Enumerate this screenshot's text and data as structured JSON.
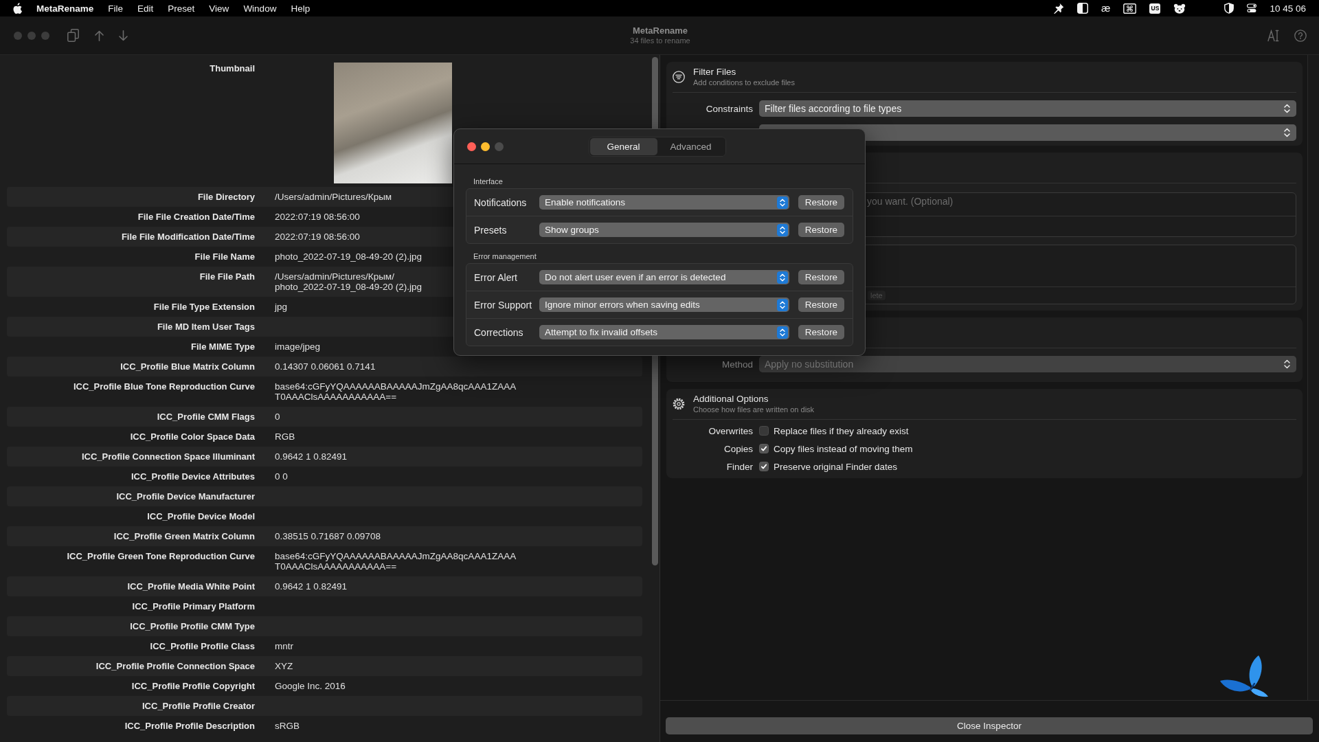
{
  "menu_bar": {
    "app_name": "MetaRename",
    "menus": [
      "File",
      "Edit",
      "Preset",
      "View",
      "Window",
      "Help"
    ],
    "input_glyph": "æ",
    "keyboard_layout": "US",
    "clock": "10 45 06"
  },
  "toolbar": {
    "title": "MetaRename",
    "subtitle": "34 files to rename"
  },
  "metadata": {
    "thumbnail_label": "Thumbnail",
    "rows": [
      {
        "label": "File Directory",
        "value": "/Users/admin/Pictures/Крым"
      },
      {
        "label": "File File Creation Date/Time",
        "value": "2022:07:19 08:56:00"
      },
      {
        "label": "File File Modification Date/Time",
        "value": "2022:07:19 08:56:00"
      },
      {
        "label": "File File Name",
        "value": "photo_2022-07-19_08-49-20 (2).jpg"
      },
      {
        "label": "File File Path",
        "value": "/Users/admin/Pictures/Крым/\nphoto_2022-07-19_08-49-20 (2).jpg"
      },
      {
        "label": "File File Type Extension",
        "value": "jpg"
      },
      {
        "label": "File MD Item User Tags"
      },
      {
        "label": "File MIME Type",
        "value": "image/jpeg"
      },
      {
        "label": "ICC_Profile Blue Matrix Column",
        "value": "0.14307 0.06061 0.7141"
      },
      {
        "label": "ICC_Profile Blue Tone Reproduction Curve",
        "value": "base64:cGFyYQAAAAAABAAAAAJmZgAA8qcAAA1ZAAA\nT0AAAClsAAAAAAAAAAA=="
      },
      {
        "label": "ICC_Profile CMM Flags",
        "value": "0"
      },
      {
        "label": "ICC_Profile Color Space Data",
        "value": "RGB"
      },
      {
        "label": "ICC_Profile Connection Space Illuminant",
        "value": "0.9642 1 0.82491"
      },
      {
        "label": "ICC_Profile Device Attributes",
        "value": "0 0"
      },
      {
        "label": "ICC_Profile Device Manufacturer"
      },
      {
        "label": "ICC_Profile Device Model"
      },
      {
        "label": "ICC_Profile Green Matrix Column",
        "value": "0.38515 0.71687 0.09708"
      },
      {
        "label": "ICC_Profile Green Tone Reproduction Curve",
        "value": "base64:cGFyYQAAAAAABAAAAAJmZgAA8qcAAA1ZAAA\nT0AAAClsAAAAAAAAAAA=="
      },
      {
        "label": "ICC_Profile Media White Point",
        "value": "0.9642 1 0.82491"
      },
      {
        "label": "ICC_Profile Primary Platform"
      },
      {
        "label": "ICC_Profile Profile CMM Type"
      },
      {
        "label": "ICC_Profile Profile Class",
        "value": "mntr"
      },
      {
        "label": "ICC_Profile Profile Connection Space",
        "value": "XYZ"
      },
      {
        "label": "ICC_Profile Profile Copyright",
        "value": "Google Inc. 2016"
      },
      {
        "label": "ICC_Profile Profile Creator"
      },
      {
        "label": "ICC_Profile Profile Description",
        "value": "sRGB"
      }
    ]
  },
  "inspector": {
    "filter_files": {
      "title": "Filter Files",
      "subtitle": "Add conditions to exclude files",
      "constraints": {
        "label": "Constraints",
        "value": "Filter files according to file types"
      }
    },
    "covered_section": {
      "placeholder": "you want. (Optional)",
      "token": "lete"
    },
    "substitution": {
      "label": "Method",
      "value": "Apply no substitution",
      "disabled": true
    },
    "additional_options": {
      "title": "Additional Options",
      "subtitle": "Choose how files are written on disk",
      "options": [
        {
          "label": "Overwrites",
          "text": "Replace files if they already exist",
          "checked": false
        },
        {
          "label": "Copies",
          "text": "Copy files instead of moving them",
          "checked": true
        },
        {
          "label": "Finder",
          "text": "Preserve original Finder dates",
          "checked": true
        }
      ]
    },
    "close_button": "Close Inspector"
  },
  "preferences_dialog": {
    "tabs": [
      {
        "label": "General",
        "selected": true
      },
      {
        "label": "Advanced",
        "selected": false
      }
    ],
    "groups": [
      {
        "title": "Interface",
        "rows": [
          {
            "label": "Notifications",
            "value": "Enable notifications",
            "button": "Restore"
          },
          {
            "label": "Presets",
            "value": "Show groups",
            "button": "Restore"
          }
        ]
      },
      {
        "title": "Error management",
        "rows": [
          {
            "label": "Error Alert",
            "value": "Do not alert user even if an error is detected",
            "button": "Restore"
          },
          {
            "label": "Error Support",
            "value": "Ignore minor errors when saving edits",
            "button": "Restore"
          },
          {
            "label": "Corrections",
            "value": "Attempt to fix invalid offsets",
            "button": "Restore"
          }
        ]
      }
    ]
  }
}
